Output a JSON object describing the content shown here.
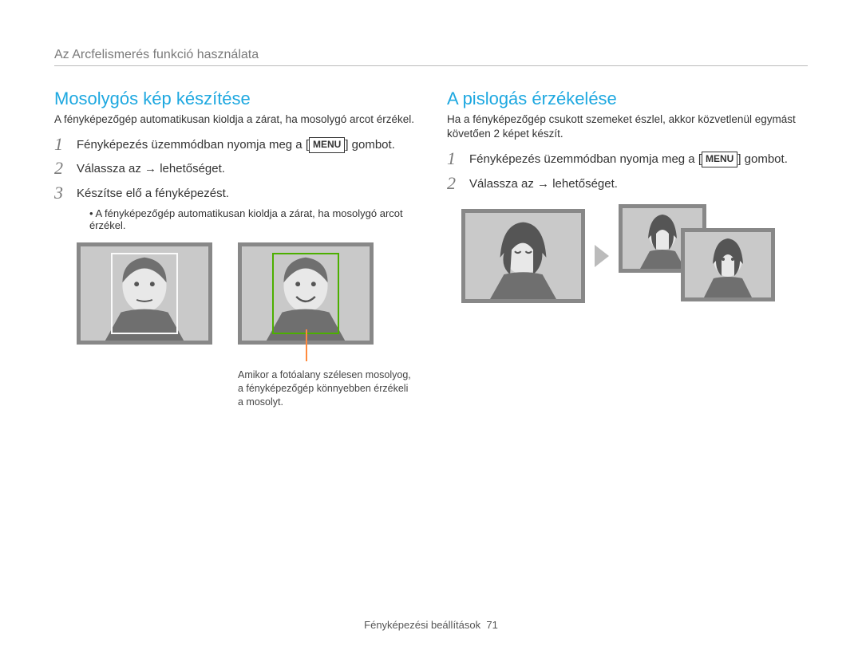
{
  "breadcrumb": "Az Arcfelismerés funkció használata",
  "left": {
    "title": "Mosolygós kép készítése",
    "intro": "A fényképezőgép automatikusan kioldja a zárat, ha mosolygó arcot érzékel.",
    "steps": [
      {
        "n": "1",
        "text_before": "Fényképezés üzemmódban nyomja meg a [",
        "menu": "MENU",
        "text_after": "] gombot."
      },
      {
        "n": "2",
        "text_before": "Válassza az                         → lehetőséget.",
        "menu": "",
        "text_after": ""
      },
      {
        "n": "3",
        "text_before": "Készítse elő a fényképezést.",
        "menu": "",
        "text_after": ""
      }
    ],
    "sub_bullet": "A fényképezőgép automatikusan kioldja a zárat, ha mosolygó arcot érzékel.",
    "callout": "Amikor a fotóalany szélesen mosolyog, a fényképezőgép könnyebben érzékeli a mosolyt."
  },
  "right": {
    "title": "A pislogás érzékelése",
    "intro": "Ha a fényképezőgép csukott szemeket észlel, akkor közvetlenül egymást követően 2 képet készít.",
    "steps": [
      {
        "n": "1",
        "text_before": "Fényképezés üzemmódban nyomja meg a [",
        "menu": "MENU",
        "text_after": "] gombot."
      },
      {
        "n": "2",
        "text_before": "Válassza az                         → lehetőséget.",
        "menu": "",
        "text_after": ""
      }
    ]
  },
  "footer": {
    "label": "Fényképezési beállítások",
    "page": "71"
  }
}
